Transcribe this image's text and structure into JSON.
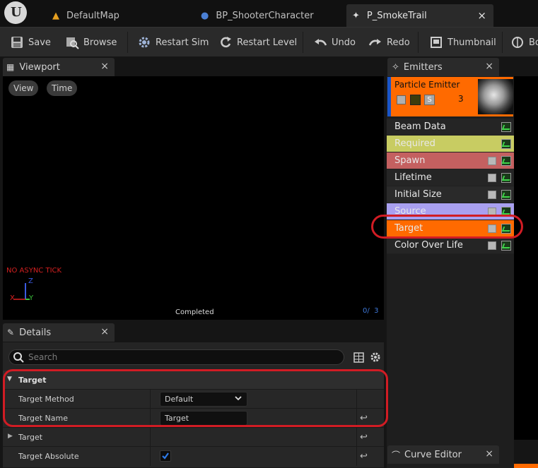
{
  "tabs": [
    {
      "label": "DefaultMap",
      "icon": "level-icon"
    },
    {
      "label": "BP_ShooterCharacter",
      "icon": "character-icon"
    },
    {
      "label": "P_SmokeTrail",
      "icon": "particle-icon",
      "close": "×"
    }
  ],
  "toolbar": {
    "save": "Save",
    "browse": "Browse",
    "restart_sim": "Restart Sim",
    "restart_level": "Restart Level",
    "undo": "Undo",
    "redo": "Redo",
    "thumbnail": "Thumbnail",
    "bounds_partial": "Bo"
  },
  "viewport": {
    "title": "Viewport",
    "close": "×",
    "view_btn": "View",
    "time_btn": "Time",
    "async_warning": "NO ASYNC TICK",
    "axis_z": "Z",
    "axis_y": "Y",
    "axis_x": "X",
    "status": "Completed",
    "counter": "0/  3"
  },
  "emitters": {
    "title": "Emitters",
    "close": "×",
    "emitter_name": "Particle Emitter",
    "emitter_mode": "S",
    "emitter_count": "3",
    "modules": [
      {
        "label": "Beam Data",
        "has_check": false
      },
      {
        "label": "Required",
        "has_check": false
      },
      {
        "label": "Spawn",
        "has_check": true
      },
      {
        "label": "Lifetime",
        "has_check": true
      },
      {
        "label": "Initial Size",
        "has_check": true
      },
      {
        "label": "Source",
        "has_check": true
      },
      {
        "label": "Target",
        "has_check": true
      },
      {
        "label": "Color Over Life",
        "has_check": true
      }
    ]
  },
  "details": {
    "title": "Details",
    "close": "×",
    "search_placeholder": "Search",
    "category": "Target",
    "rows": [
      {
        "name": "Target Method",
        "value": "Default"
      },
      {
        "name": "Target Name",
        "value": "Target"
      },
      {
        "name": "Target"
      },
      {
        "name": "Target Absolute",
        "checked": true
      }
    ]
  },
  "curve_editor": {
    "title": "Curve Editor",
    "close": "×"
  },
  "colors": {
    "accent_orange": "#ff6a00",
    "required_yellow": "#c8cc62",
    "spawn_red": "#c46060",
    "source_purple": "#a9a0f0",
    "annotation_red": "#d11c24"
  }
}
